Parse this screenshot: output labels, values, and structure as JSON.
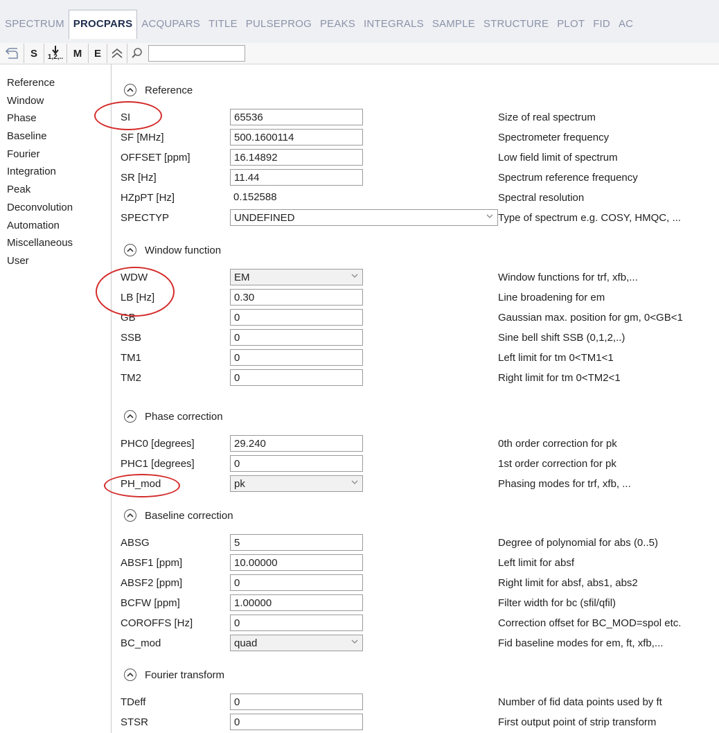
{
  "tabs": [
    {
      "label": "SPECTRUM",
      "active": false
    },
    {
      "label": "PROCPARS",
      "active": true
    },
    {
      "label": "ACQUPARS",
      "active": false
    },
    {
      "label": "TITLE",
      "active": false
    },
    {
      "label": "PULSEPROG",
      "active": false
    },
    {
      "label": "PEAKS",
      "active": false
    },
    {
      "label": "INTEGRALS",
      "active": false
    },
    {
      "label": "SAMPLE",
      "active": false
    },
    {
      "label": "STRUCTURE",
      "active": false
    },
    {
      "label": "PLOT",
      "active": false
    },
    {
      "label": "FID",
      "active": false
    },
    {
      "label": "AC",
      "active": false
    }
  ],
  "toolbar": {
    "s_label": "S",
    "sort_label": "1,2,..",
    "m_label": "M",
    "e_label": "E",
    "search_value": "",
    "icons": [
      "back-arrow-icon",
      "sort-down-icon",
      "collapse-all-icon",
      "search-icon"
    ]
  },
  "sidebar": {
    "items": [
      "Reference",
      "Window",
      "Phase",
      "Baseline",
      "Fourier",
      "Integration",
      "Peak",
      "Deconvolution",
      "Automation",
      "Miscellaneous",
      "User"
    ]
  },
  "sections": {
    "reference": {
      "title": "Reference",
      "rows": [
        {
          "label": "SI",
          "value": "65536",
          "kind": "input",
          "desc": "Size of real spectrum"
        },
        {
          "label": "SF [MHz]",
          "value": "500.1600114",
          "kind": "input",
          "desc": "Spectrometer frequency"
        },
        {
          "label": "OFFSET [ppm]",
          "value": "16.14892",
          "kind": "input",
          "desc": "Low field limit of spectrum"
        },
        {
          "label": "SR [Hz]",
          "value": "11.44",
          "kind": "input",
          "desc": "Spectrum reference frequency"
        },
        {
          "label": "HZpPT [Hz]",
          "value": "0.152588",
          "kind": "text",
          "desc": "Spectral resolution"
        },
        {
          "label": "SPECTYP",
          "value": "UNDEFINED",
          "kind": "wide-select",
          "desc": "Type of spectrum e.g. COSY, HMQC, ..."
        }
      ]
    },
    "window": {
      "title": "Window function",
      "rows": [
        {
          "label": "WDW",
          "value": "EM",
          "kind": "select",
          "desc": "Window functions for trf, xfb,..."
        },
        {
          "label": "LB [Hz]",
          "value": "0.30",
          "kind": "input",
          "desc": "Line broadening for em"
        },
        {
          "label": "GB",
          "value": "0",
          "kind": "input",
          "desc": "Gaussian max. position for gm, 0<GB<1"
        },
        {
          "label": "SSB",
          "value": "0",
          "kind": "input",
          "desc": "Sine bell shift SSB (0,1,2,..)"
        },
        {
          "label": "TM1",
          "value": "0",
          "kind": "input",
          "desc": "Left limit for tm 0<TM1<1"
        },
        {
          "label": "TM2",
          "value": "0",
          "kind": "input",
          "desc": "Right limit for tm 0<TM2<1"
        }
      ]
    },
    "phase": {
      "title": "Phase correction",
      "rows": [
        {
          "label": "PHC0 [degrees]",
          "value": "29.240",
          "kind": "input",
          "desc": "0th order correction for pk"
        },
        {
          "label": "PHC1 [degrees]",
          "value": "0",
          "kind": "input",
          "desc": "1st order correction for pk"
        },
        {
          "label": "PH_mod",
          "value": "pk",
          "kind": "select",
          "desc": "Phasing modes for trf, xfb, ..."
        }
      ]
    },
    "baseline": {
      "title": "Baseline correction",
      "rows": [
        {
          "label": "ABSG",
          "value": "5",
          "kind": "input",
          "desc": "Degree of polynomial for abs (0..5)"
        },
        {
          "label": "ABSF1 [ppm]",
          "value": "10.00000",
          "kind": "input",
          "desc": "Left limit for absf"
        },
        {
          "label": "ABSF2 [ppm]",
          "value": "0",
          "kind": "input",
          "desc": "Right limit for absf, abs1, abs2"
        },
        {
          "label": "BCFW [ppm]",
          "value": "1.00000",
          "kind": "input",
          "desc": "Filter width for bc (sfil/qfil)"
        },
        {
          "label": "COROFFS [Hz]",
          "value": "0",
          "kind": "input",
          "desc": "Correction offset for BC_MOD=spol etc."
        },
        {
          "label": "BC_mod",
          "value": "quad",
          "kind": "select",
          "desc": "Fid baseline modes for em, ft, xfb,..."
        }
      ]
    },
    "fourier": {
      "title": "Fourier transform",
      "rows": [
        {
          "label": "TDeff",
          "value": "0",
          "kind": "input",
          "desc": "Number of fid data points used by ft"
        },
        {
          "label": "STSR",
          "value": "0",
          "kind": "input",
          "desc": "First output point of strip transform"
        }
      ]
    }
  },
  "colors": {
    "active_tab_text": "#1f2d4d",
    "inactive_tab_text": "#8a93a8",
    "annotation_red": "#d42b2b"
  }
}
